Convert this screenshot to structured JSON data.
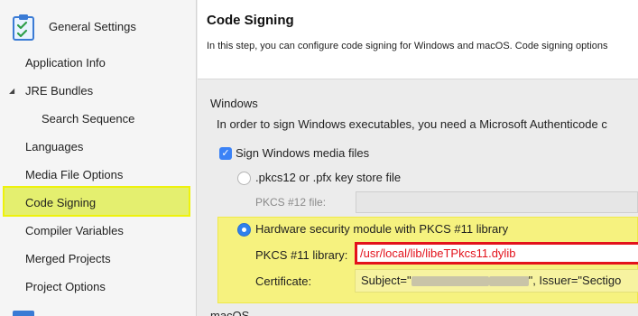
{
  "sidebar": {
    "title": "General Settings",
    "items": [
      {
        "label": "Application Info"
      },
      {
        "label": "JRE Bundles"
      },
      {
        "label": "Search Sequence"
      },
      {
        "label": "Languages"
      },
      {
        "label": "Media File Options"
      },
      {
        "label": "Code Signing"
      },
      {
        "label": "Compiler Variables"
      },
      {
        "label": "Merged Projects"
      },
      {
        "label": "Project Options"
      }
    ],
    "selected": "Code Signing",
    "highlight_color": "#eef20c"
  },
  "main": {
    "title": "Code Signing",
    "description": "In this step, you can configure code signing for Windows and macOS. Code signing options",
    "windows": {
      "section_label": "Windows",
      "description": "In order to sign Windows executables, you need a Microsoft Authenticode c",
      "sign_checkbox": {
        "label": "Sign Windows media files",
        "checked": true
      },
      "option_pkcs12": {
        "label": ".pkcs12 or .pfx key store file",
        "selected": false
      },
      "pkcs12_file": {
        "label": "PKCS #12 file:",
        "value": ""
      },
      "option_hsm": {
        "label": "Hardware security module with PKCS #11 library",
        "selected": true
      },
      "pkcs11_library": {
        "label": "PKCS #11 library:",
        "value": "/usr/local/lib/libeTPkcs11.dylib"
      },
      "certificate": {
        "label": "Certificate:",
        "prefix": "Subject=\"",
        "suffix": "\", Issuer=\"Sectigo"
      }
    },
    "macos": {
      "section_label": "macOS"
    }
  },
  "colors": {
    "accent": "#2f80ed",
    "highlight": "#f6f27f",
    "error_border": "#e3121b"
  }
}
